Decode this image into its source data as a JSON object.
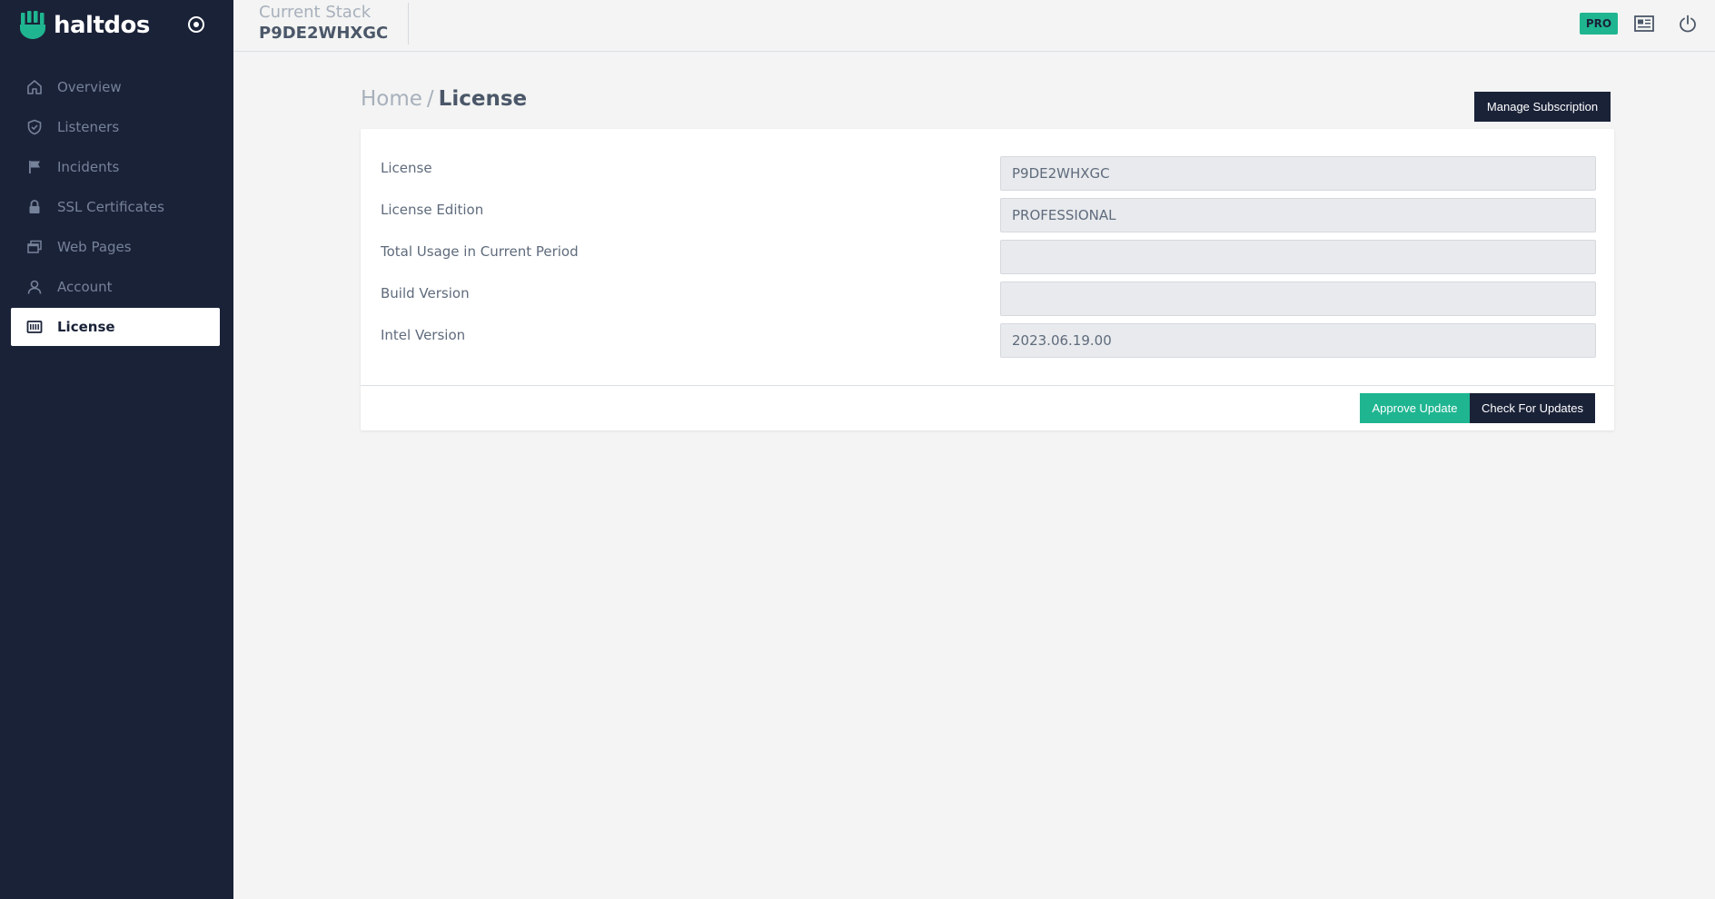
{
  "brand": {
    "name": "haltdos",
    "logo_icon": "haltdos-logo-icon",
    "accent_color": "#1fb591"
  },
  "sidebar": {
    "background": "#1a2238",
    "items": [
      {
        "label": "Overview",
        "icon": "home-icon",
        "active": false
      },
      {
        "label": "Listeners",
        "icon": "shield-icon",
        "active": false
      },
      {
        "label": "Incidents",
        "icon": "flag-icon",
        "active": false
      },
      {
        "label": "SSL Certificates",
        "icon": "lock-icon",
        "active": false
      },
      {
        "label": "Web Pages",
        "icon": "windows-icon",
        "active": false
      },
      {
        "label": "Account",
        "icon": "user-icon",
        "active": false
      },
      {
        "label": "License",
        "icon": "license-icon",
        "active": true
      }
    ]
  },
  "topbar": {
    "stack_label": "Current Stack",
    "stack_id": "P9DE2WHXGC",
    "badge": "PRO"
  },
  "breadcrumb": {
    "home": "Home",
    "separator": "/",
    "current": "License"
  },
  "actions": {
    "manage_subscription": "Manage Subscription"
  },
  "license_form": {
    "fields": [
      {
        "label": "License",
        "value": "P9DE2WHXGC"
      },
      {
        "label": "License Edition",
        "value": "PROFESSIONAL"
      },
      {
        "label": "Total Usage in Current Period",
        "value": ""
      },
      {
        "label": "Build Version",
        "value": ""
      },
      {
        "label": "Intel Version",
        "value": "2023.06.19.00"
      }
    ],
    "approve_update": "Approve Update",
    "check_for_updates": "Check For Updates"
  }
}
